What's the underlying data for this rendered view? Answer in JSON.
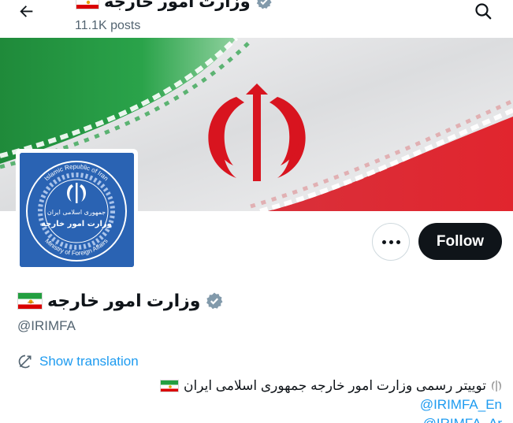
{
  "header": {
    "name": "وزارت امور خارجه",
    "posts_count": "11.1K posts"
  },
  "profile": {
    "display_name": "وزارت امور خارجه",
    "handle": "@IRIMFA",
    "follow_label": "Follow",
    "show_translation_label": "Show translation",
    "bio": "توییتر رسمی وزارت امور خارجه جمهوری اسلامی ایران",
    "links": [
      "@IRIMFA_En",
      "@IRIMFA_Ar"
    ]
  },
  "avatar": {
    "ring_text_top": "Islamic Republic of Iran",
    "ring_text_bottom": "Ministry of Foreign Affairs",
    "center_line_1": "جمهوری اسلامی ایران",
    "center_line_2": "وزارت امور خارجه"
  },
  "colors": {
    "accent": "#1d9bf0",
    "verified_badge": "#829aab",
    "follow_bg": "#0f1419",
    "secondary_text": "#536471",
    "flag_green": "#239f40",
    "flag_red": "#da0000",
    "seal_blue": "#2a63b3"
  },
  "icons": {
    "back": "arrow-left-icon",
    "search": "search-icon",
    "more": "more-dots-icon",
    "verified": "verified-badge-icon",
    "translate": "translate-icon",
    "flag": "lion-and-sun-flag-icon",
    "emblem": "iran-emblem-icon"
  }
}
